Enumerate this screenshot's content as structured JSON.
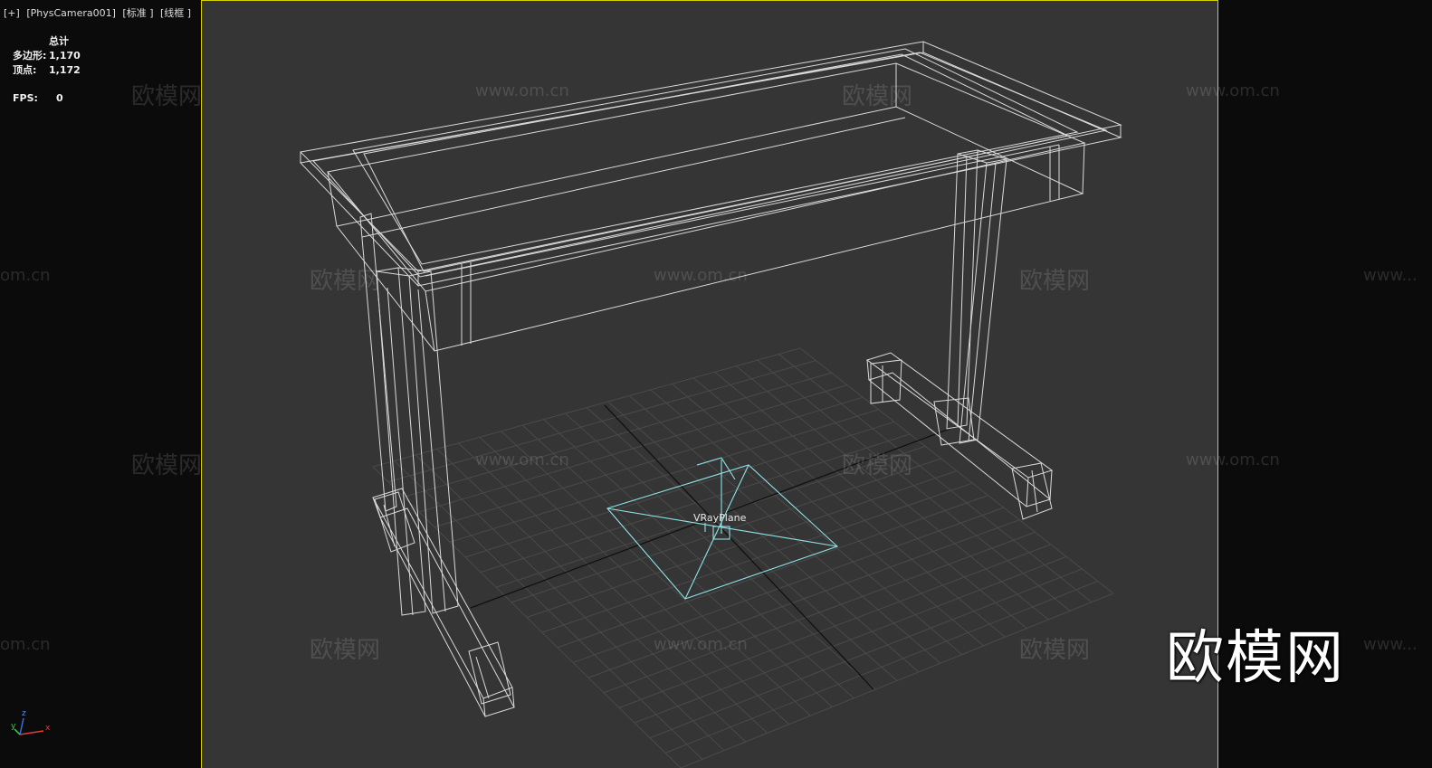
{
  "viewport": {
    "label_plus": "[+]",
    "label_camera": "[PhysCamera001]",
    "label_shading": "[标准 ]",
    "label_mode": "[线框 ]"
  },
  "stats": {
    "total_label": "总计",
    "polys_label": "多边形:",
    "polys_value": "1,170",
    "verts_label": "顶点:",
    "verts_value": "1,172",
    "fps_label": "FPS:",
    "fps_value": "0"
  },
  "scene": {
    "object_label": "VRayPlane",
    "wire_color": "#e8e8e8",
    "grid_color": "#4a4a4a",
    "plane_color": "#8fe3e6"
  },
  "watermarks": {
    "cn": "欧模网",
    "url": "www.om.cn",
    "url_short": "om.cn",
    "url_cut": "www..."
  },
  "brand": {
    "text": "欧模网"
  },
  "axis": {
    "x": "x",
    "y": "y",
    "z": "z"
  }
}
